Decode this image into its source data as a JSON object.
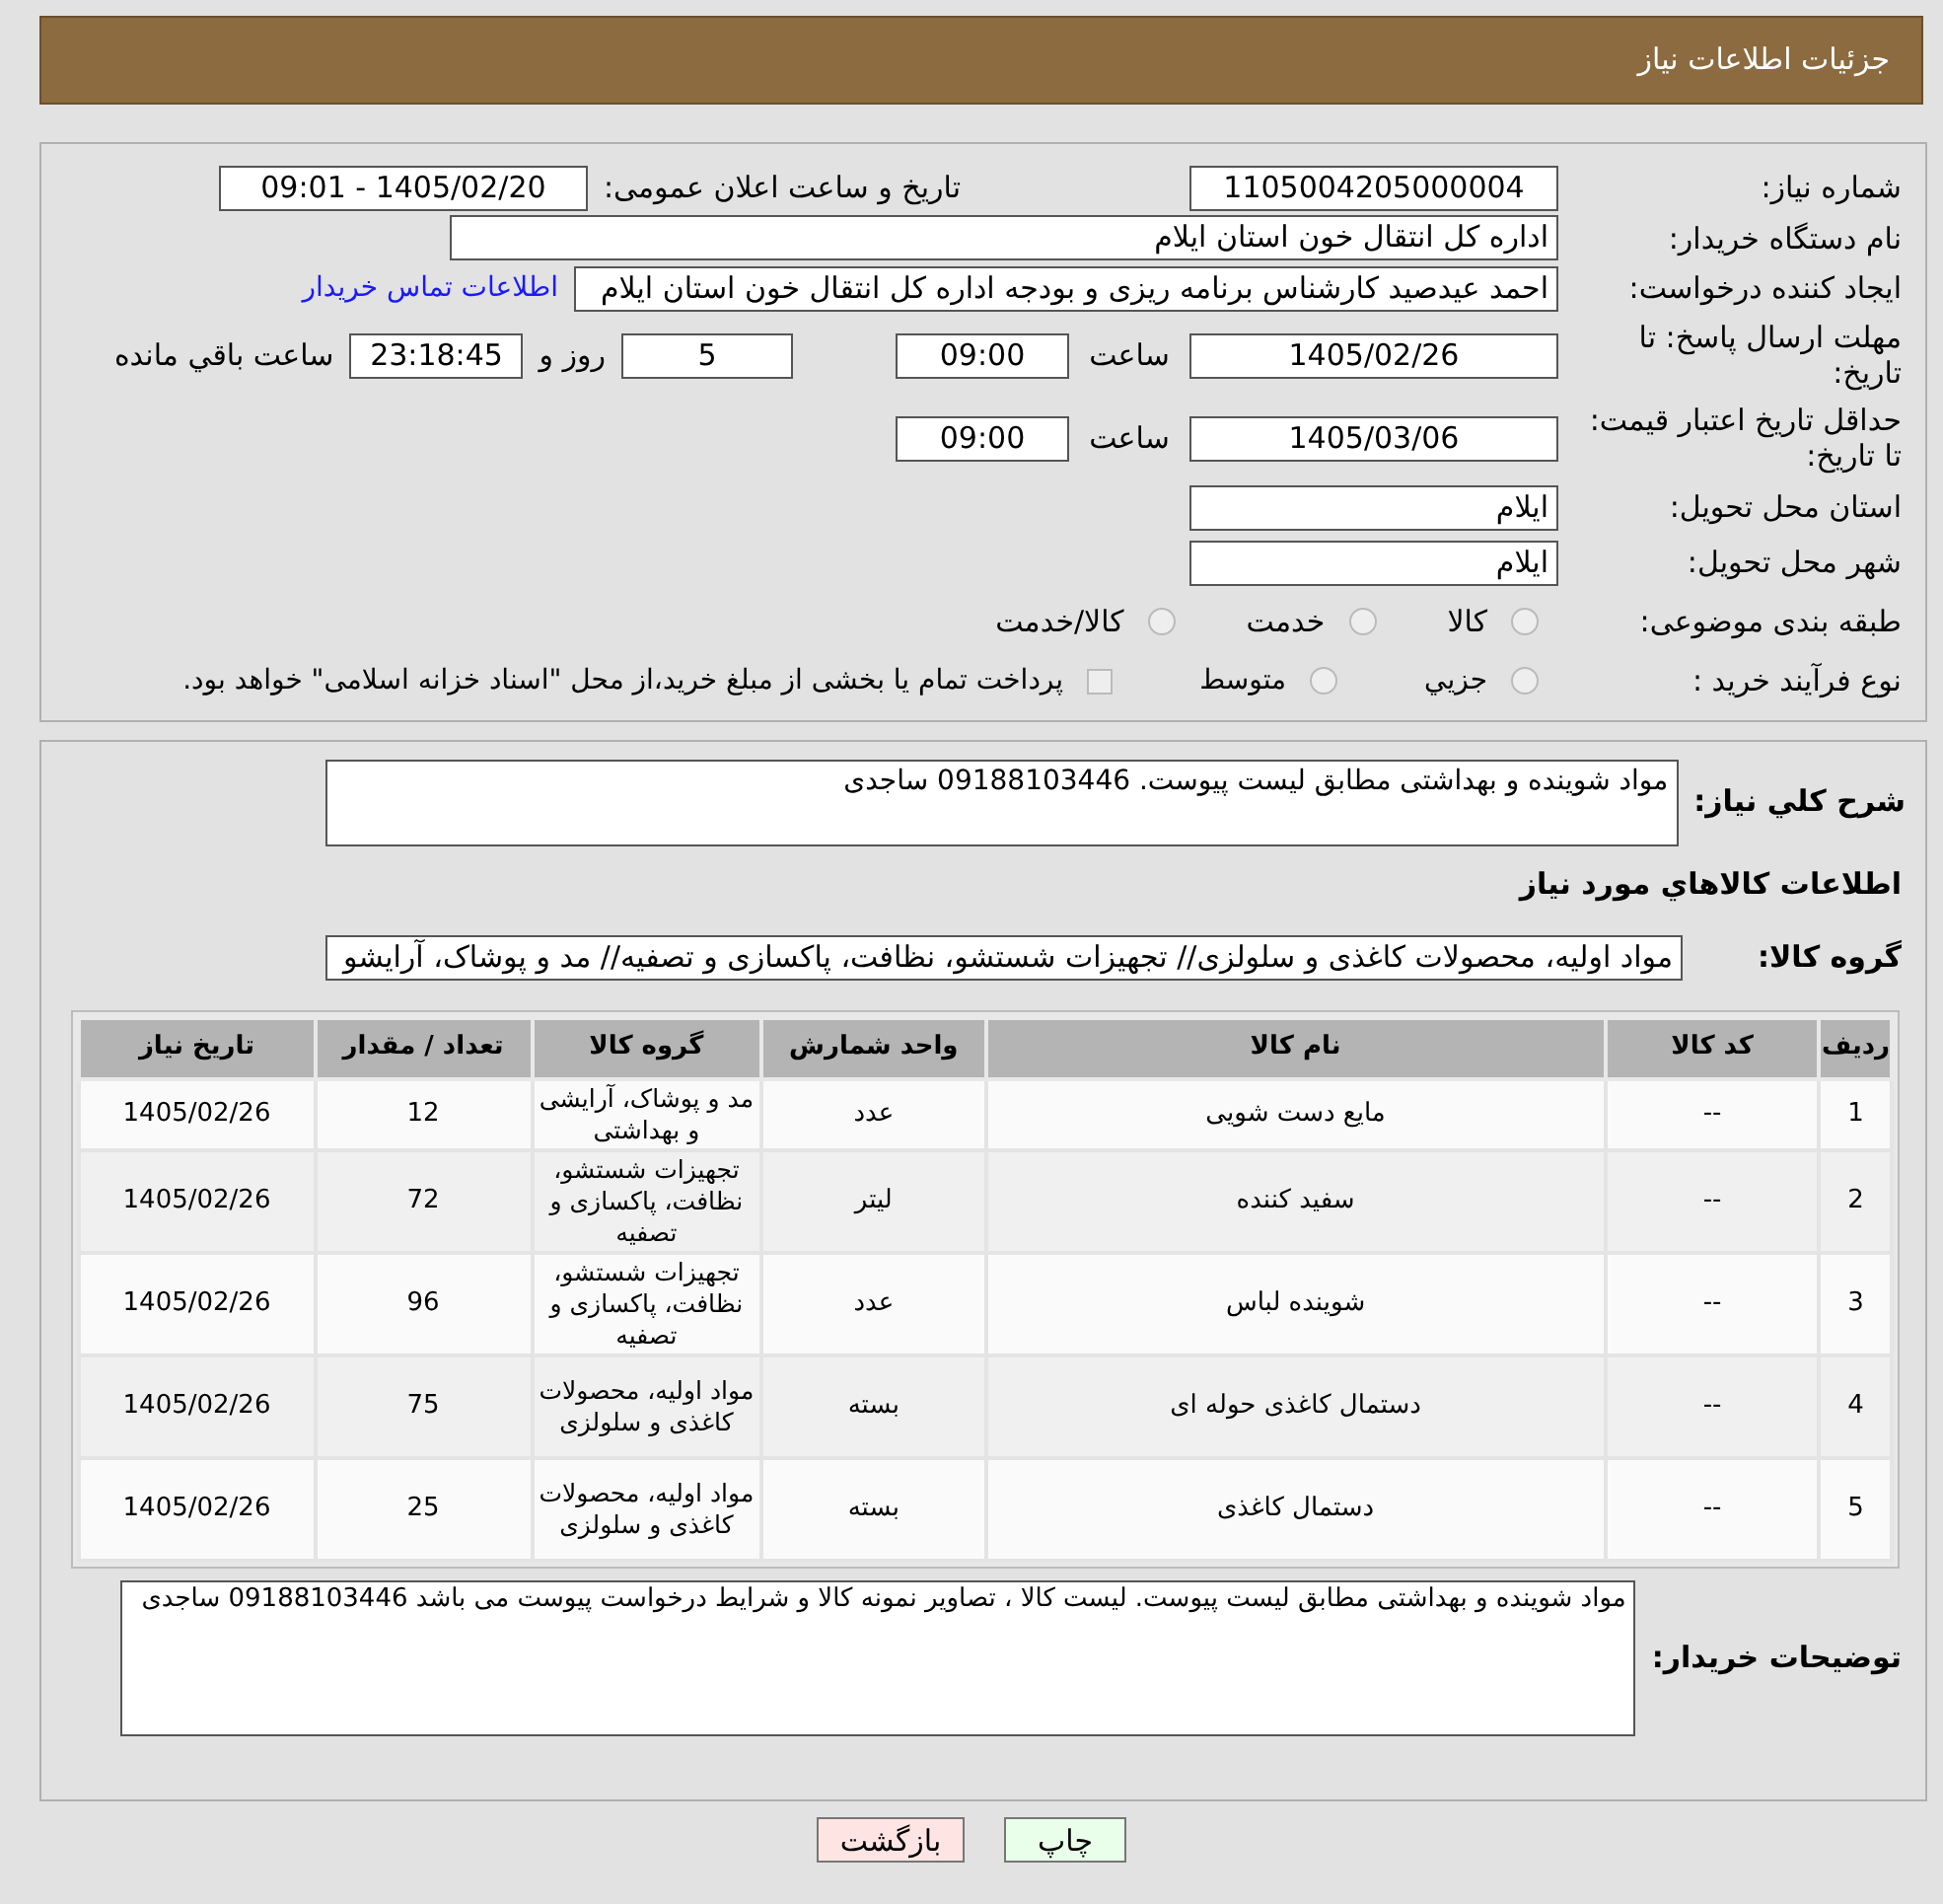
{
  "header": {
    "title": "جزئيات اطلاعات نياز"
  },
  "details": {
    "need_number": {
      "label": "شماره نیاز:",
      "value": "1105004205000004"
    },
    "announce": {
      "label": "تاریخ و ساعت اعلان عمومی:",
      "value": "1405/02/20 - 09:01"
    },
    "buyer": {
      "label": "نام دستگاه خریدار:",
      "value": "اداره کل انتقال خون استان ایلام"
    },
    "requester": {
      "label": "ایجاد کننده درخواست:",
      "value": "احمد عیدصید کارشناس برنامه ریزی و بودجه اداره کل انتقال خون استان ایلام",
      "link": "اطلاعات تماس خریدار"
    },
    "deadline": {
      "label": "مهلت ارسال پاسخ: تا تاریخ:",
      "date": "1405/02/26",
      "time_label": "ساعت",
      "time": "09:00",
      "days": "5",
      "days_label": "روز و",
      "remaining": "23:18:45",
      "remaining_label": "ساعت باقي مانده"
    },
    "price_validity": {
      "label": "حداقل تاریخ اعتبار قیمت: تا تاریخ:",
      "date": "1405/03/06",
      "time_label": "ساعت",
      "time": "09:00"
    },
    "province": {
      "label": "استان محل تحویل:",
      "value": "ایلام"
    },
    "city": {
      "label": "شهر محل تحویل:",
      "value": "ایلام"
    },
    "category": {
      "label": "طبقه بندی موضوعی:",
      "options": [
        {
          "label": "کالا",
          "selected": false
        },
        {
          "label": "خدمت",
          "selected": false
        },
        {
          "label": "کالا/خدمت",
          "selected": false
        }
      ]
    },
    "process": {
      "label": "نوع فرآیند خرید :",
      "options": [
        {
          "kind": "radio",
          "label": "جزيي",
          "selected": false
        },
        {
          "kind": "radio",
          "label": "متوسط",
          "selected": false
        },
        {
          "kind": "checkbox",
          "label": "پرداخت تمام یا بخشی از مبلغ خرید،از محل \"اسناد خزانه اسلامی\" خواهد بود.",
          "checked": false
        }
      ]
    }
  },
  "summary": {
    "label": "شرح کلي نياز:",
    "value": "مواد شوینده و بهداشتی مطابق لیست پیوست. 09188103446 ساجدی"
  },
  "goods_heading": "اطلاعات کالاهاي مورد نياز",
  "goods_group": {
    "label": "گروه کالا:",
    "value": "مواد اولیه، محصولات کاغذی و سلولزی// تجهیزات شستشو، نظافت، پاکسازی و تصفیه// مد و پوشاک، آرایشو"
  },
  "table": {
    "columns": [
      "ردیف",
      "کد کالا",
      "نام کالا",
      "واحد شمارش",
      "گروه کالا",
      "تعداد / مقدار",
      "تاریخ نیاز"
    ],
    "rows": [
      [
        "1",
        "--",
        "مایع دست شویی",
        "عدد",
        "مد و پوشاک، آرایشی و بهداشتی",
        "12",
        "1405/02/26"
      ],
      [
        "2",
        "--",
        "سفید کننده",
        "لیتر",
        "تجهیزات شستشو، نظافت، پاکسازی و تصفیه",
        "72",
        "1405/02/26"
      ],
      [
        "3",
        "--",
        "شوینده لباس",
        "عدد",
        "تجهیزات شستشو، نظافت، پاکسازی و تصفیه",
        "96",
        "1405/02/26"
      ],
      [
        "4",
        "--",
        "دستمال کاغذی حوله ای",
        "بسته",
        "مواد اولیه، محصولات کاغذی و سلولزی",
        "75",
        "1405/02/26"
      ],
      [
        "5",
        "--",
        "دستمال کاغذی",
        "بسته",
        "مواد اولیه، محصولات کاغذی و سلولزی",
        "25",
        "1405/02/26"
      ]
    ]
  },
  "buyer_notes": {
    "label": "توضیحات خریدار:",
    "value": "مواد شوینده و بهداشتی مطابق لیست پیوست. لیست کالا ، تصاویر نمونه کالا و شرایط درخواست پیوست می باشد 09188103446 ساجدی"
  },
  "buttons": [
    {
      "kind": "print",
      "label": "چاپ"
    },
    {
      "kind": "back",
      "label": "بازگشت"
    }
  ]
}
